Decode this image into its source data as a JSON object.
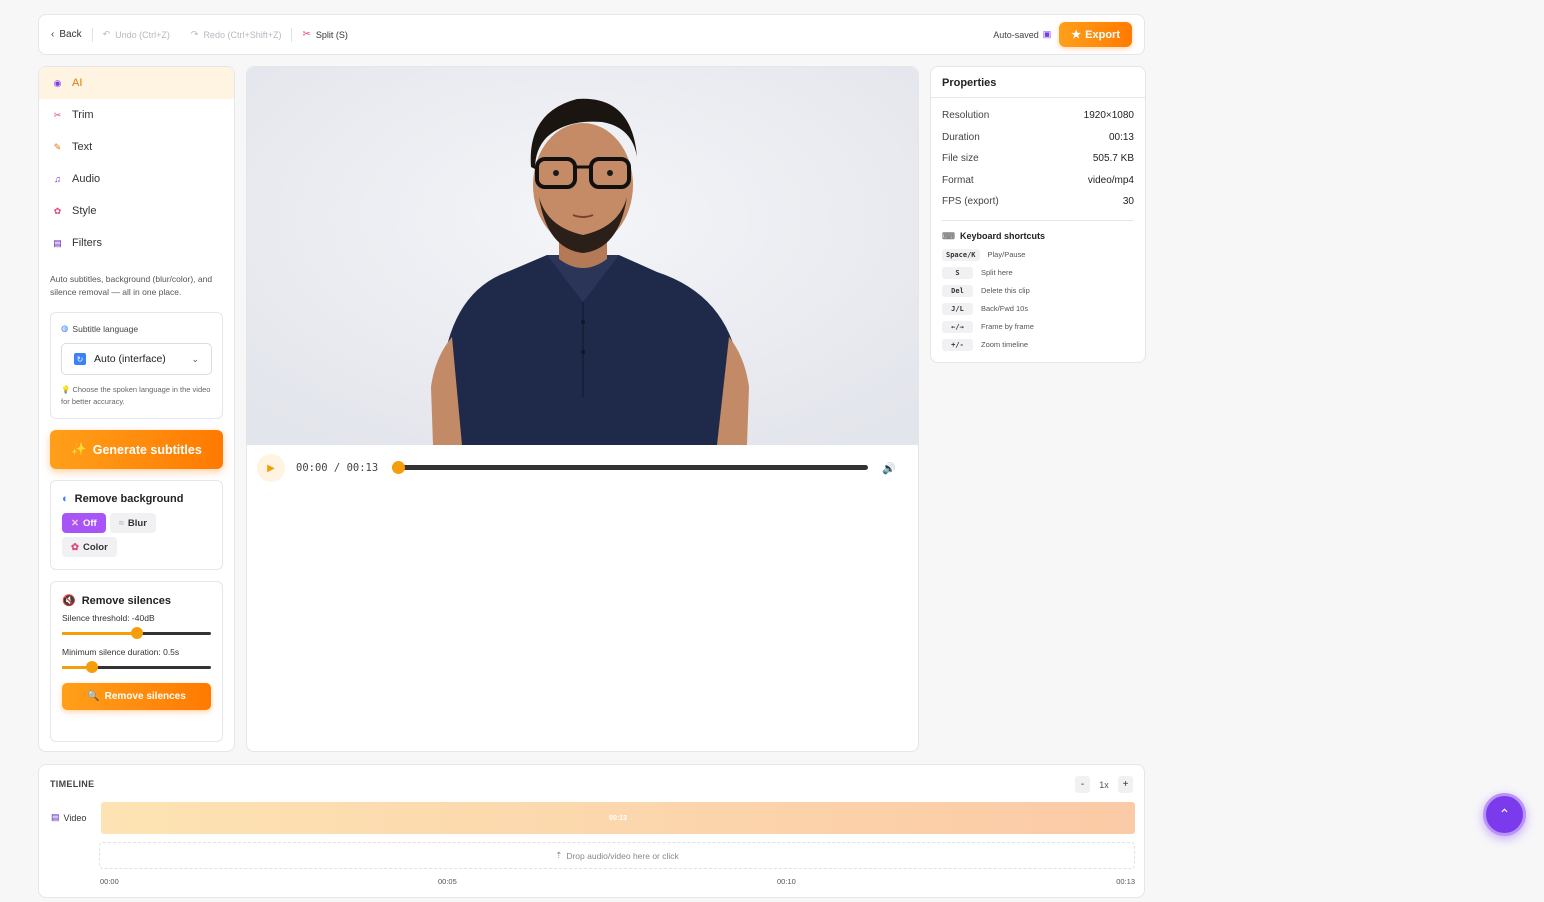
{
  "toolbar": {
    "back": "Back",
    "undo": "Undo (Ctrl+Z)",
    "redo": "Redo (Ctrl+Shift+Z)",
    "split": "Split (S)",
    "autosaved": "Auto-saved",
    "export": "Export"
  },
  "sidebar": {
    "items": [
      {
        "label": "AI",
        "icon": "robot-icon"
      },
      {
        "label": "Trim",
        "icon": "scissors-icon"
      },
      {
        "label": "Text",
        "icon": "memo-icon"
      },
      {
        "label": "Audio",
        "icon": "music-note-icon"
      },
      {
        "label": "Style",
        "icon": "palette-icon"
      },
      {
        "label": "Filters",
        "icon": "clapper-icon"
      }
    ],
    "description": "Auto subtitles, background (blur/color), and silence removal — all in one place.",
    "subtitle_language": {
      "label": "Subtitle language",
      "selected": "Auto (interface)",
      "hint": "Choose the spoken language in the video for better accuracy."
    },
    "generate_button": "Generate subtitles",
    "remove_background": {
      "title": "Remove background",
      "options": [
        "Off",
        "Blur",
        "Color"
      ],
      "selected": "Off"
    },
    "remove_silences": {
      "title": "Remove silences",
      "threshold_label": "Silence threshold: -40dB",
      "threshold_fraction": 0.5,
      "min_duration_label": "Minimum silence duration: 0.5s",
      "min_duration_fraction": 0.2,
      "button": "Remove silences"
    }
  },
  "player": {
    "current_time": "00:00",
    "separator": " / ",
    "total_time": "00:13",
    "progress_fraction": 0
  },
  "properties": {
    "title": "Properties",
    "rows": [
      {
        "key": "Resolution",
        "value": "1920×1080"
      },
      {
        "key": "Duration",
        "value": "00:13"
      },
      {
        "key": "File size",
        "value": "505.7 KB"
      },
      {
        "key": "Format",
        "value": "video/mp4"
      },
      {
        "key": "FPS (export)",
        "value": "30"
      }
    ],
    "shortcuts_title": "Keyboard shortcuts",
    "shortcuts": [
      {
        "key": "Space/K",
        "desc": "Play/Pause"
      },
      {
        "key": "S",
        "desc": "Split here"
      },
      {
        "key": "Del",
        "desc": "Delete this clip"
      },
      {
        "key": "J/L",
        "desc": "Back/Fwd 10s"
      },
      {
        "key": "←/→",
        "desc": "Frame by frame"
      },
      {
        "key": "+/-",
        "desc": "Zoom timeline"
      }
    ]
  },
  "timeline": {
    "title": "TIMELINE",
    "zoom_minus": "-",
    "zoom_level": "1x",
    "zoom_plus": "+",
    "video_track_label": "Video",
    "clip_label": "00:13",
    "drop_text": "Drop audio/video here or click",
    "ticks": [
      "00:00",
      "00:05",
      "00:10",
      "00:13"
    ]
  },
  "colors": {
    "accent_orange": "#ff8a00",
    "active_purple": "#a855f7",
    "scroll_top_purple": "#7c3aed"
  }
}
